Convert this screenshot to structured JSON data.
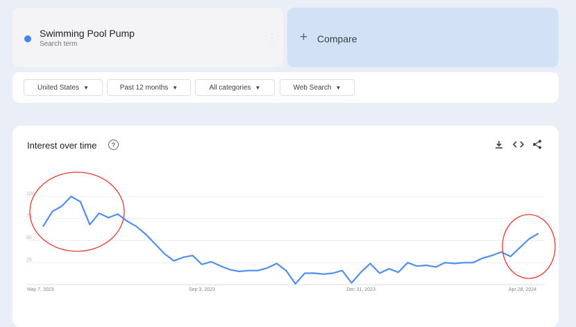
{
  "search": {
    "term": "Swimming Pool Pump",
    "subtitle": "Search term",
    "term_color": "#4285f4"
  },
  "compare": {
    "label": "Compare"
  },
  "filters": {
    "region": "United States",
    "time": "Past 12 months",
    "category": "All categories",
    "property": "Web Search"
  },
  "chart_header": {
    "title": "Interest over time",
    "icons": [
      "download-icon",
      "embed-code-icon",
      "share-icon"
    ]
  },
  "annotations": [
    {
      "shape": "ellipse",
      "color": "#e3362d",
      "region": "early peak (May–Jun 2023)"
    },
    {
      "shape": "ellipse",
      "color": "#e3362d",
      "region": "recent rise (Apr 2024)"
    }
  ],
  "chart_data": {
    "type": "line",
    "title": "",
    "xlabel": "",
    "ylabel": "",
    "ylim": [
      0,
      100
    ],
    "y_ticks": [
      25,
      50,
      75,
      100
    ],
    "x_tick_labels": [
      "May 7, 2023",
      "Sep 3, 2023",
      "Dec 31, 2023",
      "Apr 28, 2024"
    ],
    "x_tick_indices": [
      0,
      17,
      34,
      51
    ],
    "grid": true,
    "line_color": "#4f8ef0",
    "series": [
      {
        "values": [
          66,
          83,
          89,
          100,
          94,
          68,
          81,
          76,
          80,
          72,
          66,
          57,
          46,
          35,
          27,
          31,
          33,
          23,
          26,
          21,
          17,
          15,
          16,
          16,
          19,
          24,
          16,
          1,
          13,
          13,
          12,
          13,
          16,
          2,
          14,
          24,
          13,
          18,
          14,
          25,
          21,
          22,
          20,
          25,
          24,
          25,
          25,
          30,
          33,
          37,
          32,
          42,
          52,
          58
        ]
      }
    ]
  }
}
